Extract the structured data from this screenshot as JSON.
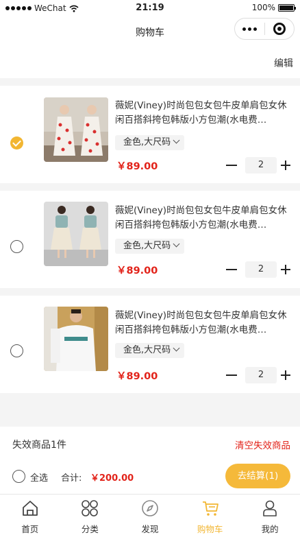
{
  "status_bar": {
    "carrier": "WeChat",
    "time": "21:19",
    "battery": "100%"
  },
  "nav": {
    "title": "购物车"
  },
  "edit_label": "编辑",
  "cart_items": [
    {
      "title": "薇妮(Viney)时尚包包女包牛皮单肩包女休闲百搭斜挎包韩版小方包潮(水电费…",
      "sku": "金色,大尺码",
      "price": "￥89.00",
      "qty": "2",
      "checked": true,
      "thumb": "dress-photo"
    },
    {
      "title": "薇妮(Viney)时尚包包女包牛皮单肩包女休闲百搭斜挎包韩版小方包潮(水电费…",
      "sku": "金色,大尺码",
      "price": "￥89.00",
      "qty": "2",
      "checked": false,
      "thumb": "outfit-photo"
    },
    {
      "title": "薇妮(Viney)时尚包包女包牛皮单肩包女休闲百搭斜挎包韩版小方包潮(水电费…",
      "sku": "金色,大尺码",
      "price": "￥89.00",
      "qty": "2",
      "checked": false,
      "thumb": "sweater-photo"
    }
  ],
  "invalid": {
    "label": "失效商品1件",
    "clear": "清空失效商品"
  },
  "checkout": {
    "select_all": "全选",
    "total_label": "合计:",
    "total": "￥200.00",
    "button": "去结算(1)"
  },
  "tabbar": [
    {
      "label": "首页",
      "icon": "home-icon"
    },
    {
      "label": "分类",
      "icon": "category-icon"
    },
    {
      "label": "发现",
      "icon": "compass-icon"
    },
    {
      "label": "购物车",
      "icon": "cart-icon",
      "active": true
    },
    {
      "label": "我的",
      "icon": "user-icon"
    }
  ],
  "colors": {
    "accent": "#f2b632",
    "price": "#e2231a",
    "checkout_button": "#f5b93a"
  }
}
